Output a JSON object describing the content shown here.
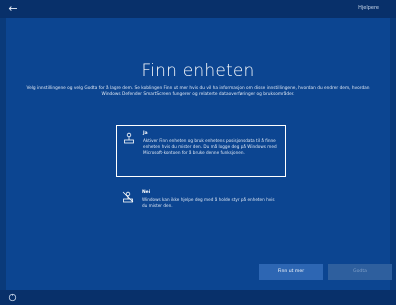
{
  "topbar": {
    "back_icon": "back-arrow-icon",
    "tools_label": "Hjelpere"
  },
  "page": {
    "title": "Finn enheten",
    "description": "Velg innstillingene og velg Godta for å lagre dem. Se koblingen Finn ut mer hvis du vil ha informasjon om disse innstillingene, hvordan du endrer dem, hvordan Windows Defender SmartScreen fungerer og relaterte dataoverføringer og bruksområder."
  },
  "options": [
    {
      "icon": "find-device-icon",
      "title": "Ja",
      "body": "Aktiver Finn enheten og bruk enhetens posisjonsdata til å finne enheten hvis du mister den. Du må logge deg på Windows med Microsoft-kontoen for å bruke denne funksjonen.",
      "selected": true
    },
    {
      "icon": "no-find-device-icon",
      "title": "Nei",
      "body": "Windows kan ikke hjelpe deg med å holde styr på enheten hvis du mister den.",
      "selected": false
    }
  ],
  "buttons": {
    "learn_more": "Finn ut mer",
    "accept": "Godta"
  },
  "bottombar": {
    "accessibility_icon": "accessibility-icon"
  },
  "colors": {
    "background": "#0c4591",
    "frame": "#08306a",
    "primary_button": "#2d66b3",
    "disabled_button": "#2e5f9e"
  }
}
